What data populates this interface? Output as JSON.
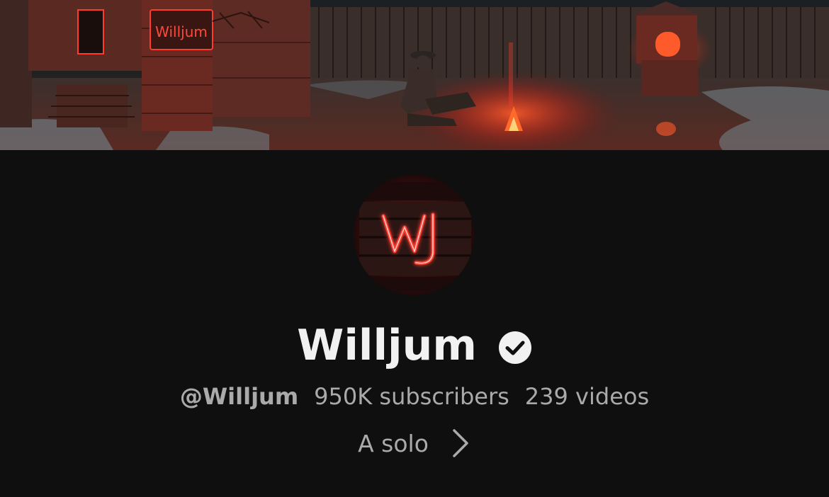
{
  "banner": {
    "sign_text": "Willjum",
    "description": "illustrated banner art"
  },
  "avatar": {
    "logo_text": "WJ"
  },
  "channel": {
    "name": "Willjum",
    "verified": true,
    "handle": "@Willjum",
    "subscribers": "950K subscribers",
    "videos": "239 videos",
    "description": "A solo"
  },
  "icons": {
    "verified": "verified-check-icon",
    "more": "chevron-right-icon"
  },
  "colors": {
    "background": "#0f0f0f",
    "title_text": "#f1f1f1",
    "secondary_text": "#aaaaaa",
    "neon_red": "#ff3b2f"
  }
}
